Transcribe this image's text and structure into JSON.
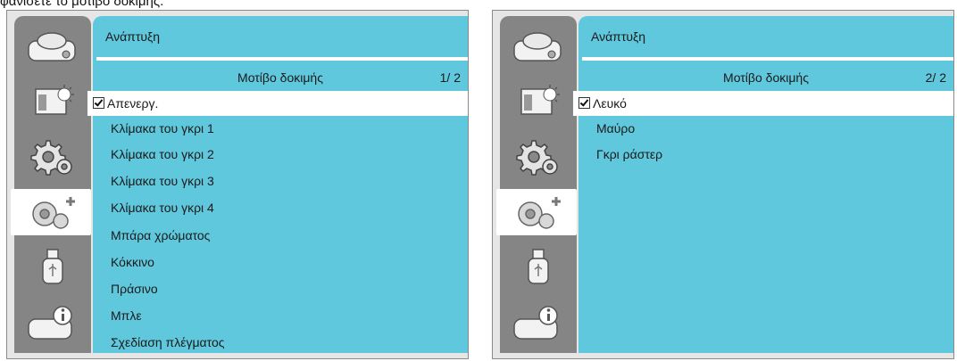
{
  "caption": "φανίσετε το μοτίβο δοκιμής.",
  "panels": [
    {
      "menu_title": "Ανάπτυξη",
      "subheader": "Μοτίβο δοκιμής",
      "page_indicator": "1/ 2",
      "items": [
        {
          "label": "Απενεργ.",
          "selected": true
        },
        {
          "label": "Κλίμακα του γκρι 1"
        },
        {
          "label": "Κλίμακα του γκρι 2"
        },
        {
          "label": "Κλίμακα του γκρι 3"
        },
        {
          "label": "Κλίμακα του γκρι 4"
        },
        {
          "label": "Μπάρα χρώματος"
        },
        {
          "label": "Κόκκινο"
        },
        {
          "label": "Πράσινο"
        },
        {
          "label": "Μπλε"
        },
        {
          "label": "Σχεδίαση πλέγματος"
        }
      ]
    },
    {
      "menu_title": "Ανάπτυξη",
      "subheader": "Μοτίβο δοκιμής",
      "page_indicator": "2/ 2",
      "items": [
        {
          "label": "Λευκό",
          "selected": true
        },
        {
          "label": "Μαύρο"
        },
        {
          "label": "Γκρι ράστερ"
        }
      ]
    }
  ],
  "sidebar_icons": [
    "projector-icon",
    "picture-brightness-icon",
    "gear-settings-icon",
    "advanced-gears-plus-icon",
    "usb-icon",
    "info-icon"
  ],
  "active_sidebar_icon": "advanced-gears-plus-icon",
  "colors": {
    "menu_bg": "#5fc8dd",
    "sidebar_bg": "#858585",
    "selected_bg": "#ffffff",
    "panel_bg": "#e6e6e6"
  }
}
